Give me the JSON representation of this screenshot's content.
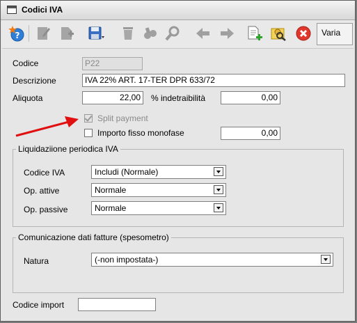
{
  "window": {
    "title": "Codici IVA"
  },
  "toolbar": {
    "varia_label": "Varia",
    "buttons": [
      "help-star-icon",
      "edit-icon",
      "new-document-icon",
      "save-icon",
      "delete-icon",
      "binoculars-icon",
      "search-icon",
      "back-arrow-icon",
      "forward-arrow-icon",
      "add-document-icon",
      "find-user-icon",
      "close-icon"
    ]
  },
  "form": {
    "codice_label": "Codice",
    "codice_value": "P22",
    "descrizione_label": "Descrizione",
    "descrizione_value": "IVA 22% ART. 17-TER DPR 633/72",
    "aliquota_label": "Aliquota",
    "aliquota_value": "22,00",
    "indetraibilita_label": "% indetraibilità",
    "indetraibilita_value": "0,00",
    "split_payment_label": "Split payment",
    "split_payment_checked": true,
    "importo_fisso_label": "Importo fisso monofase",
    "importo_fisso_checked": false,
    "importo_fisso_value": "0,00",
    "codice_import_label": "Codice import",
    "codice_import_value": ""
  },
  "liquidazione": {
    "title": "Liquidaziione periodica IVA",
    "codice_iva_label": "Codice IVA",
    "codice_iva_value": "Includi (Normale)",
    "op_attive_label": "Op. attive",
    "op_attive_value": "Normale",
    "op_passive_label": "Op. passive",
    "op_passive_value": "Normale"
  },
  "comunicazione": {
    "title": "Comunicazione dati fatture (spesometro)",
    "natura_label": "Natura",
    "natura_value": "(-non impostata-)"
  },
  "colors": {
    "annotation_arrow": "#e01010"
  }
}
